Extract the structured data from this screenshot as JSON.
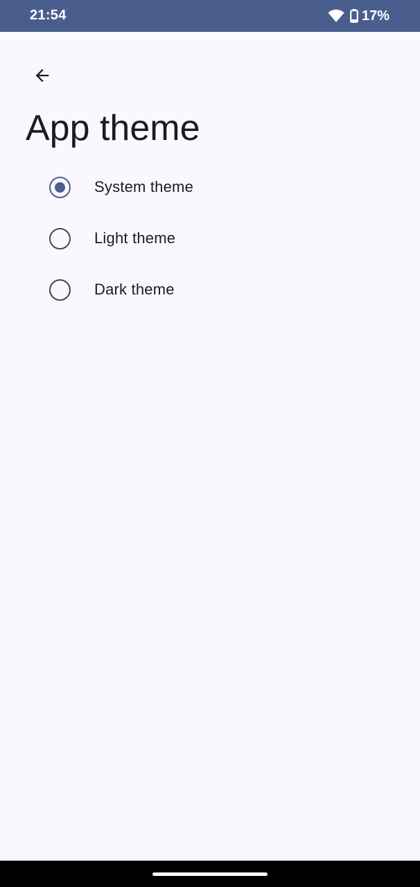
{
  "status_bar": {
    "time": "21:54",
    "battery_percent": "17%",
    "icons": [
      "wifi-icon",
      "battery-icon"
    ],
    "background": "#4a5e8e"
  },
  "header": {
    "back_icon": "arrow-back-icon",
    "title": "App theme"
  },
  "theme_options": [
    {
      "label": "System theme",
      "selected": true
    },
    {
      "label": "Light theme",
      "selected": false
    },
    {
      "label": "Dark theme",
      "selected": false
    }
  ],
  "colors": {
    "accent": "#4a5e8e",
    "background": "#fbf8fd",
    "text": "#1b1b21"
  }
}
